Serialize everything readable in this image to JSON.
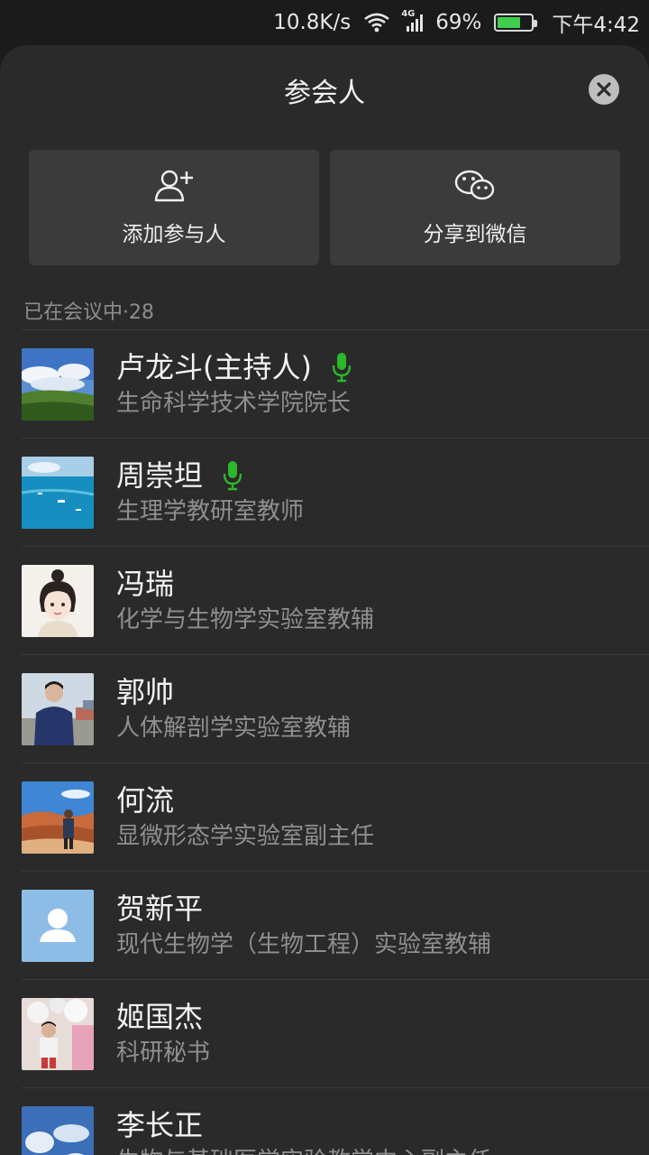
{
  "status_bar": {
    "speed": "10.8K/s",
    "network": "4G",
    "battery": "69%",
    "battery_level": 0.69,
    "time": "下午4:42"
  },
  "sheet": {
    "title": "参会人",
    "actions": {
      "add_label": "添加参与人",
      "share_label": "分享到微信"
    },
    "section_header": "已在会议中·28",
    "participants": [
      {
        "name": "卢龙斗(主持人)",
        "role": "生命科学技术学院院长",
        "mic": true
      },
      {
        "name": "周崇坦",
        "role": "生理学教研室教师",
        "mic": true
      },
      {
        "name": "冯瑞",
        "role": "化学与生物学实验室教辅",
        "mic": false
      },
      {
        "name": "郭帅",
        "role": "人体解剖学实验室教辅",
        "mic": false
      },
      {
        "name": "何流",
        "role": "显微形态学实验室副主任",
        "mic": false
      },
      {
        "name": "贺新平",
        "role": "现代生物学（生物工程）实验室教辅",
        "mic": false
      },
      {
        "name": "姬国杰",
        "role": "科研秘书",
        "mic": false
      },
      {
        "name": "李长正",
        "role": "生物与基础医学实验教学中心副主任",
        "mic": false
      }
    ]
  },
  "colors": {
    "mic_active": "#2bb62b",
    "sheet_bg": "#2a2a2a",
    "button_bg": "#3b3b3b"
  }
}
